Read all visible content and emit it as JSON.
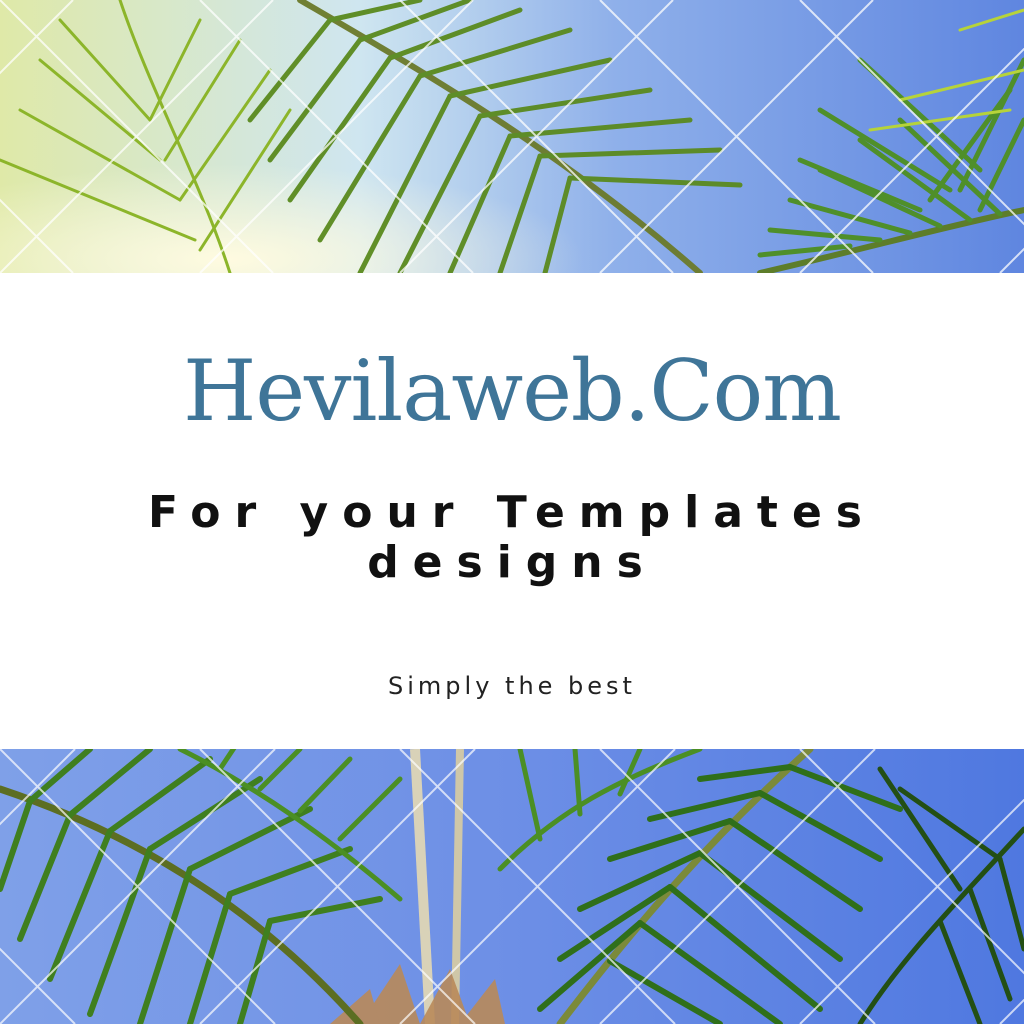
{
  "banner": {
    "brand": "Hevilaweb.Com",
    "tagline_line1": "For your Templates",
    "tagline_line2": "designs",
    "subtitle": "Simply the best"
  },
  "colors": {
    "brand": "#3f7598",
    "tagline": "#111111",
    "subtitle": "#222222",
    "sky": "#6f8fe0",
    "palm": "#4f8f2a",
    "panel": "#ffffff"
  },
  "images": {
    "top": "palm-fronds-against-sky-photo",
    "bottom": "palm-tree-canopy-photo"
  }
}
